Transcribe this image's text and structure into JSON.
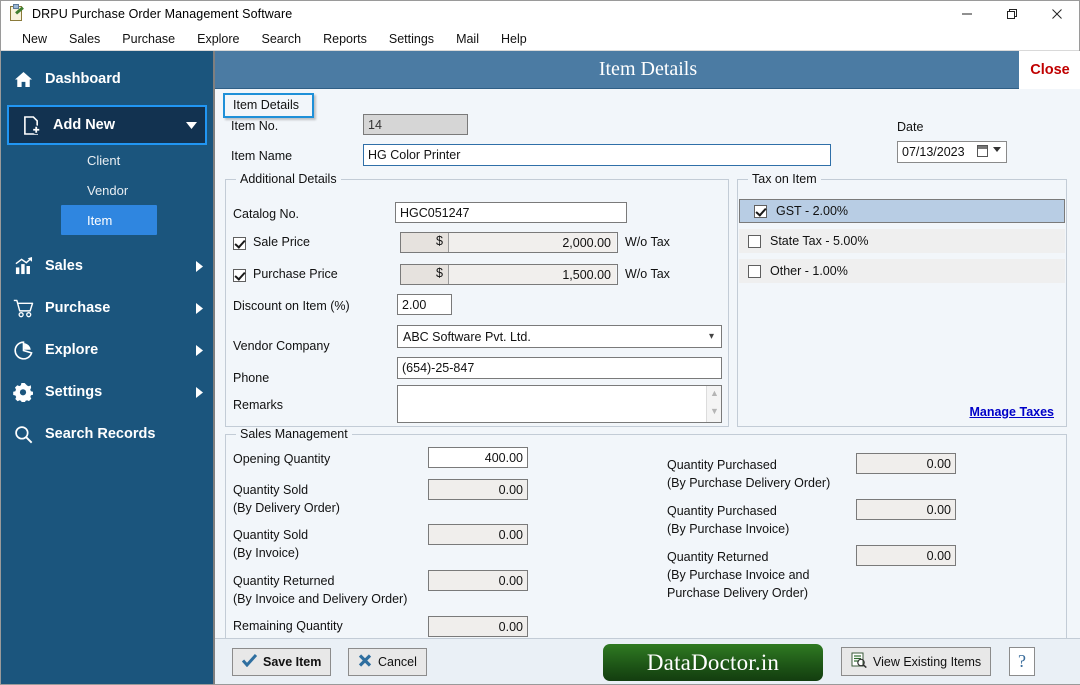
{
  "window": {
    "title": "DRPU Purchase Order Management Software",
    "minimize": "—",
    "maximize": "❐",
    "close": "✕"
  },
  "menubar": [
    "New",
    "Sales",
    "Purchase",
    "Explore",
    "Search",
    "Reports",
    "Settings",
    "Mail",
    "Help"
  ],
  "sidebar": {
    "dashboard": "Dashboard",
    "add_new": "Add New",
    "sub_items": [
      "Client",
      "Vendor",
      "Item"
    ],
    "active_sub": "Item",
    "items": [
      {
        "label": "Sales",
        "icon": "chart-bar-icon"
      },
      {
        "label": "Purchase",
        "icon": "shopping-cart-icon"
      },
      {
        "label": "Explore",
        "icon": "pie-chart-icon"
      },
      {
        "label": "Settings",
        "icon": "gear-icon"
      },
      {
        "label": "Search Records",
        "icon": "magnifier-icon"
      }
    ]
  },
  "header": {
    "title": "Item Details",
    "close_label": "Close"
  },
  "tab": {
    "label": "Item Details"
  },
  "top_form": {
    "item_no_label": "Item No.",
    "item_no_value": "14",
    "item_name_label": "Item Name",
    "item_name_value": "HG Color Printer",
    "date_label": "Date",
    "date_value": "07/13/2023"
  },
  "additional_details": {
    "legend": "Additional Details",
    "catalog_label": "Catalog No.",
    "catalog_value": "HGC051247",
    "sale_price_label": "Sale Price",
    "sale_price_checked": true,
    "sale_price_currency": "$",
    "sale_price_value": "2,000.00",
    "sale_price_suffix": "W/o Tax",
    "purchase_price_label": "Purchase Price",
    "purchase_price_checked": true,
    "purchase_price_currency": "$",
    "purchase_price_value": "1,500.00",
    "purchase_price_suffix": "W/o Tax",
    "discount_label": "Discount on Item (%)",
    "discount_value": "2.00",
    "vendor_label": "Vendor Company",
    "vendor_value": "ABC Software Pvt. Ltd.",
    "phone_label": "Phone",
    "phone_value": "(654)-25-847",
    "remarks_label": "Remarks",
    "remarks_value": ""
  },
  "tax_on_item": {
    "legend": "Tax on Item",
    "rows": [
      {
        "label": "GST - 2.00%",
        "checked": true,
        "selected": true
      },
      {
        "label": "State Tax - 5.00%",
        "checked": false,
        "selected": false
      },
      {
        "label": "Other - 1.00%",
        "checked": false,
        "selected": false
      }
    ],
    "manage_link": "Manage Taxes"
  },
  "sales_management": {
    "legend": "Sales Management",
    "left": [
      {
        "label": "Opening Quantity",
        "sub": "",
        "value": "400.00",
        "editable": true
      },
      {
        "label": "Quantity Sold",
        "sub": "(By Delivery Order)",
        "value": "0.00",
        "editable": false
      },
      {
        "label": "Quantity Sold",
        "sub": "(By Invoice)",
        "value": "0.00",
        "editable": false
      },
      {
        "label": "Quantity Returned",
        "sub": "(By Invoice and Delivery Order)",
        "value": "0.00",
        "editable": false
      },
      {
        "label": "Remaining Quantity",
        "sub": "",
        "value": "0.00",
        "editable": false
      }
    ],
    "right": [
      {
        "label": "Quantity Purchased",
        "sub": "(By Purchase Delivery Order)",
        "sub2": "",
        "value": "0.00"
      },
      {
        "label": "Quantity Purchased",
        "sub": "(By Purchase Invoice)",
        "sub2": "",
        "value": "0.00"
      },
      {
        "label": "Quantity Returned",
        "sub": "(By Purchase Invoice and",
        "sub2": "Purchase Delivery Order)",
        "value": "0.00"
      }
    ]
  },
  "bottom_bar": {
    "save_label": "Save Item",
    "cancel_label": "Cancel",
    "logo_text": "DataDoctor.in",
    "view_items_label": "View Existing Items",
    "help_label": "?"
  },
  "colors": {
    "sidebar_bg": "#1b557d",
    "sidebar_active": "#2f86e0",
    "header_bg": "#4b7ba3",
    "accent_blue": "#2196f3",
    "close_red": "#c00000",
    "link_blue": "#0000c8",
    "logo_green": "#1d5416"
  }
}
